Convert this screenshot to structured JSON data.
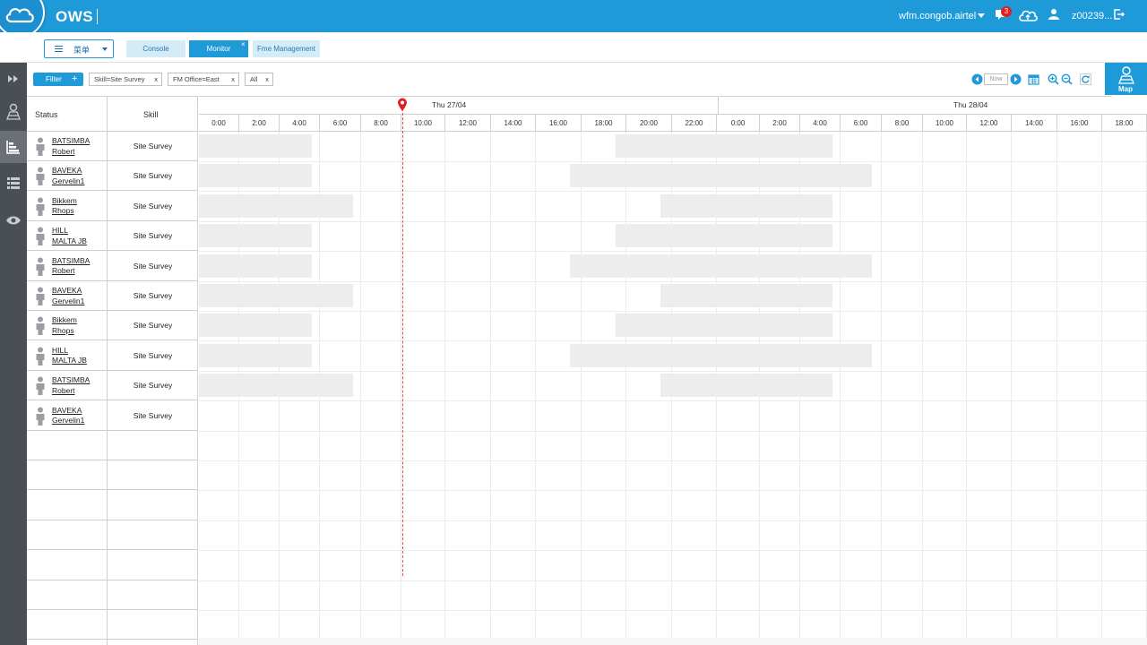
{
  "header": {
    "app_name": "OWS",
    "tenant": "wfm.congob.airtel",
    "notification_count": "3",
    "username": "z00239...",
    "brand_color": "#1f9ad8"
  },
  "toolbar": {
    "menu_label": "菜单",
    "tabs": [
      {
        "label": "Console",
        "active": false
      },
      {
        "label": "Monitor",
        "active": true,
        "close": "×"
      },
      {
        "label": "Fme Management",
        "active": false
      }
    ]
  },
  "filters": {
    "filter_label": "Filter",
    "add_label": "+",
    "chips": [
      {
        "label": "Skill=Site Survey",
        "close": "x"
      },
      {
        "label": "FM Office=East",
        "close": "x"
      },
      {
        "label": "All",
        "close": "x"
      }
    ],
    "now_label": "Now",
    "map_label": "Map"
  },
  "leftnav": {
    "items": [
      {
        "icon": "expand-icon",
        "active": false
      },
      {
        "icon": "map-person-icon",
        "active": false
      },
      {
        "icon": "gantt-icon",
        "active": true
      },
      {
        "icon": "list-icon",
        "active": false
      },
      {
        "icon": "eye-icon",
        "active": false
      }
    ]
  },
  "table": {
    "status_header": "Status",
    "skill_header": "Skill",
    "rows": [
      {
        "first": "BATSIMBA",
        "last": "Robert",
        "skill": "Site Survey"
      },
      {
        "first": "BAVEKA",
        "last": "Gervelin1",
        "skill": "Site Survey"
      },
      {
        "first": "Bikkem",
        "last": "Rhops",
        "skill": "Site Survey"
      },
      {
        "first": "HILL",
        "last": "MALTA JB",
        "skill": "Site Survey"
      },
      {
        "first": "BATSIMBA",
        "last": "Robert",
        "skill": "Site Survey"
      },
      {
        "first": "BAVEKA",
        "last": "Gervelin1",
        "skill": "Site Survey"
      },
      {
        "first": "Bikkem",
        "last": "Rhops",
        "skill": "Site Survey"
      },
      {
        "first": "HILL",
        "last": "MALTA JB",
        "skill": "Site Survey"
      },
      {
        "first": "BATSIMBA",
        "last": "Robert",
        "skill": "Site Survey"
      },
      {
        "first": "BAVEKA",
        "last": "Gervelin1",
        "skill": "Site Survey"
      }
    ]
  },
  "gantt": {
    "days": [
      "Thu 27/04",
      "Thu 28/04"
    ],
    "hours": [
      "0:00",
      "2:00",
      "4:00",
      "6:00",
      "8:00",
      "10:00",
      "12:00",
      "14:00",
      "16:00",
      "18:00",
      "20:00",
      "22:00",
      "0:00",
      "2:00",
      "4:00",
      "6:00",
      "8:00",
      "10:00",
      "12:00",
      "14:00",
      "16:00",
      "18:00"
    ],
    "now_marker_color": "#e02020",
    "schedule_bars": [
      [
        {
          "start_hour": 0,
          "end_hour": 5.6
        },
        {
          "start_hour": 19.5,
          "end_hour": 29.6
        }
      ],
      [
        {
          "start_hour": 0,
          "end_hour": 5.6
        },
        {
          "start_hour": 17.5,
          "end_hour": 31.5
        }
      ],
      [
        {
          "start_hour": 0,
          "end_hour": 7.6
        },
        {
          "start_hour": 21.5,
          "end_hour": 29.6
        }
      ],
      [
        {
          "start_hour": 0,
          "end_hour": 5.6
        },
        {
          "start_hour": 19.5,
          "end_hour": 29.6
        }
      ],
      [
        {
          "start_hour": 0,
          "end_hour": 5.6
        },
        {
          "start_hour": 17.5,
          "end_hour": 31.5
        }
      ],
      [
        {
          "start_hour": 0,
          "end_hour": 7.6
        },
        {
          "start_hour": 21.5,
          "end_hour": 29.6
        }
      ],
      [
        {
          "start_hour": 0,
          "end_hour": 5.6
        },
        {
          "start_hour": 19.5,
          "end_hour": 29.6
        }
      ],
      [
        {
          "start_hour": 0,
          "end_hour": 5.6
        },
        {
          "start_hour": 17.5,
          "end_hour": 31.5
        }
      ],
      [
        {
          "start_hour": 0,
          "end_hour": 7.6
        },
        {
          "start_hour": 21.5,
          "end_hour": 29.6
        }
      ],
      []
    ]
  }
}
